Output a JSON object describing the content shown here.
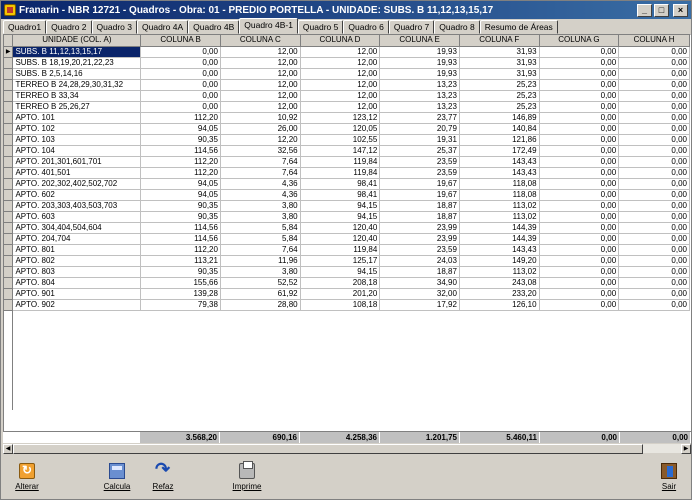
{
  "window": {
    "title": "Franarin - NBR 12721 - Quadros - Obra: 01 - PREDIO PORTELLA - UNIDADE: SUBS. B 11,12,13,15,17",
    "minimize": "_",
    "maximize": "□",
    "close": "×"
  },
  "tabs": [
    {
      "label": "Quadro1"
    },
    {
      "label": "Quadro 2"
    },
    {
      "label": "Quadro 3"
    },
    {
      "label": "Quadro 4A"
    },
    {
      "label": "Quadro 4B"
    },
    {
      "label": "Quadro 4B-1"
    },
    {
      "label": "Quadro 5"
    },
    {
      "label": "Quadro 6"
    },
    {
      "label": "Quadro 7"
    },
    {
      "label": "Quadro 8"
    },
    {
      "label": "Resumo de Áreas"
    }
  ],
  "active_tab": "Quadro 4B-1",
  "grid": {
    "row_indicator": "▶",
    "columns": [
      "UNIDADE (COL. A)",
      "COLUNA B",
      "COLUNA C",
      "COLUNA D",
      "COLUNA E",
      "COLUNA F",
      "COLUNA G",
      "COLUNA H"
    ],
    "rows": [
      [
        "SUBS. B 11,12,13,15,17",
        "0,00",
        "12,00",
        "12,00",
        "19,93",
        "31,93",
        "0,00",
        "0,00"
      ],
      [
        "SUBS. B 18,19,20,21,22,23",
        "0,00",
        "12,00",
        "12,00",
        "19,93",
        "31,93",
        "0,00",
        "0,00"
      ],
      [
        "SUBS. B 2,5,14,16",
        "0,00",
        "12,00",
        "12,00",
        "19,93",
        "31,93",
        "0,00",
        "0,00"
      ],
      [
        "TERREO B 24,28,29,30,31,32",
        "0,00",
        "12,00",
        "12,00",
        "13,23",
        "25,23",
        "0,00",
        "0,00"
      ],
      [
        "TERREO B 33,34",
        "0,00",
        "12,00",
        "12,00",
        "13,23",
        "25,23",
        "0,00",
        "0,00"
      ],
      [
        "TERREO B 25,26,27",
        "0,00",
        "12,00",
        "12,00",
        "13,23",
        "25,23",
        "0,00",
        "0,00"
      ],
      [
        "APTO. 101",
        "112,20",
        "10,92",
        "123,12",
        "23,77",
        "146,89",
        "0,00",
        "0,00"
      ],
      [
        "APTO. 102",
        "94,05",
        "26,00",
        "120,05",
        "20,79",
        "140,84",
        "0,00",
        "0,00"
      ],
      [
        "APTO. 103",
        "90,35",
        "12,20",
        "102,55",
        "19,31",
        "121,86",
        "0,00",
        "0,00"
      ],
      [
        "APTO. 104",
        "114,56",
        "32,56",
        "147,12",
        "25,37",
        "172,49",
        "0,00",
        "0,00"
      ],
      [
        "APTO. 201,301,601,701",
        "112,20",
        "7,64",
        "119,84",
        "23,59",
        "143,43",
        "0,00",
        "0,00"
      ],
      [
        "APTO. 401,501",
        "112,20",
        "7,64",
        "119,84",
        "23,59",
        "143,43",
        "0,00",
        "0,00"
      ],
      [
        "APTO. 202,302,402,502,702",
        "94,05",
        "4,36",
        "98,41",
        "19,67",
        "118,08",
        "0,00",
        "0,00"
      ],
      [
        "APTO. 602",
        "94,05",
        "4,36",
        "98,41",
        "19,67",
        "118,08",
        "0,00",
        "0,00"
      ],
      [
        "APTO. 203,303,403,503,703",
        "90,35",
        "3,80",
        "94,15",
        "18,87",
        "113,02",
        "0,00",
        "0,00"
      ],
      [
        "APTO. 603",
        "90,35",
        "3,80",
        "94,15",
        "18,87",
        "113,02",
        "0,00",
        "0,00"
      ],
      [
        "APTO. 304,404,504,604",
        "114,56",
        "5,84",
        "120,40",
        "23,99",
        "144,39",
        "0,00",
        "0,00"
      ],
      [
        "APTO. 204,704",
        "114,56",
        "5,84",
        "120,40",
        "23,99",
        "144,39",
        "0,00",
        "0,00"
      ],
      [
        "APTO. 801",
        "112,20",
        "7,64",
        "119,84",
        "23,59",
        "143,43",
        "0,00",
        "0,00"
      ],
      [
        "APTO. 802",
        "113,21",
        "11,96",
        "125,17",
        "24,03",
        "149,20",
        "0,00",
        "0,00"
      ],
      [
        "APTO. 803",
        "90,35",
        "3,80",
        "94,15",
        "18,87",
        "113,02",
        "0,00",
        "0,00"
      ],
      [
        "APTO. 804",
        "155,66",
        "52,52",
        "208,18",
        "34,90",
        "243,08",
        "0,00",
        "0,00"
      ],
      [
        "APTO. 901",
        "139,28",
        "61,92",
        "201,20",
        "32,00",
        "233,20",
        "0,00",
        "0,00"
      ],
      [
        "APTO. 902",
        "79,38",
        "28,80",
        "108,18",
        "17,92",
        "126,10",
        "0,00",
        "0,00"
      ]
    ]
  },
  "totals": [
    "3.568,20",
    "690,16",
    "4.258,36",
    "1.201,75",
    "5.460,11",
    "0,00",
    "0,00"
  ],
  "scrollbar": {
    "left": "◀",
    "right": "▶"
  },
  "toolbar": {
    "alterar": "Alterar",
    "calcula": "Calcula",
    "refaz": "Refaz",
    "imprime": "Imprime",
    "sair": "Sair"
  }
}
